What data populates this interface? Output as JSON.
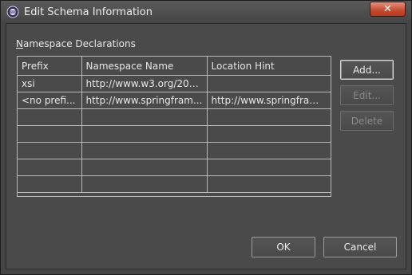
{
  "window": {
    "title": "Edit Schema Information",
    "close_glyph": "✕"
  },
  "section": {
    "label_prefix": "N",
    "label_rest": "amespace Declarations"
  },
  "table": {
    "columns": [
      "Prefix",
      "Namespace Name",
      "Location Hint"
    ],
    "rows": [
      [
        "xsi",
        "http://www.w3.org/200...",
        ""
      ],
      [
        "<no prefi...",
        "http://www.springfram...",
        "http://www.springfram..."
      ],
      [
        "",
        "",
        ""
      ],
      [
        "",
        "",
        ""
      ],
      [
        "",
        "",
        ""
      ],
      [
        "",
        "",
        ""
      ],
      [
        "",
        "",
        ""
      ]
    ]
  },
  "buttons": {
    "add": "Add...",
    "edit": "Edit...",
    "delete": "Delete",
    "ok": "OK",
    "cancel": "Cancel"
  }
}
